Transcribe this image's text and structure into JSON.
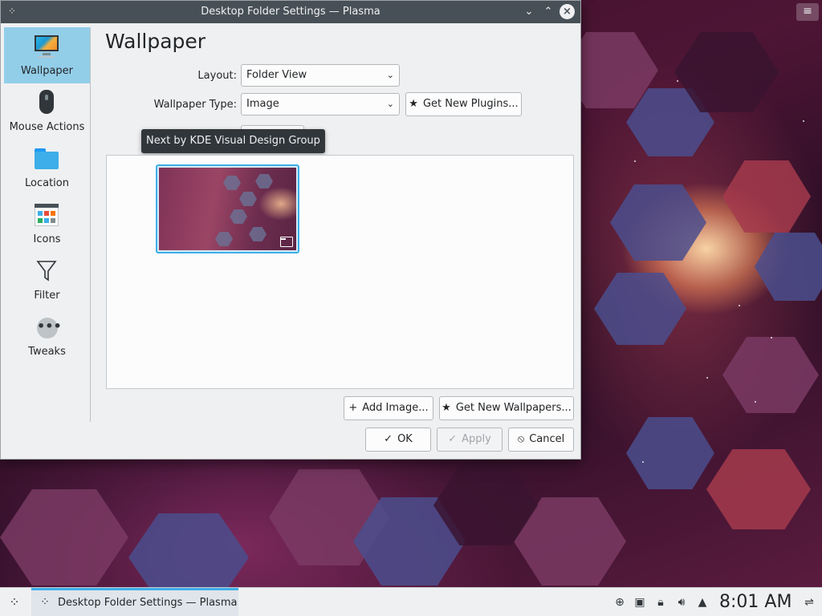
{
  "window": {
    "title": "Desktop Folder Settings — Plasma"
  },
  "sidebar": {
    "items": [
      {
        "label": "Wallpaper",
        "icon": "monitor-wallpaper-icon",
        "active": true
      },
      {
        "label": "Mouse Actions",
        "icon": "mouse-icon",
        "active": false
      },
      {
        "label": "Location",
        "icon": "folder-icon",
        "active": false
      },
      {
        "label": "Icons",
        "icon": "icons-icon",
        "active": false
      },
      {
        "label": "Filter",
        "icon": "filter-icon",
        "active": false
      },
      {
        "label": "Tweaks",
        "icon": "more-icon",
        "active": false
      }
    ]
  },
  "main": {
    "title": "Wallpaper",
    "layout_label": "Layout:",
    "layout_value": "Folder View",
    "wallpaper_type_label": "Wallpaper Type:",
    "wallpaper_type_value": "Image",
    "get_new_plugins_label": "Get New Plugins...",
    "tooltip": "Next by KDE Visual Design Group",
    "add_image_label": "Add Image...",
    "get_new_wallpapers_label": "Get New Wallpapers...",
    "ok_label": "OK",
    "apply_label": "Apply",
    "cancel_label": "Cancel"
  },
  "taskbar": {
    "task_label": "Desktop Folder Settings — Plasma",
    "clock": "8:01 AM"
  },
  "colors": {
    "accent": "#3daee9",
    "titlebar": "#475057",
    "sidebar_active": "#93cee9",
    "window_bg": "#eff0f1"
  }
}
